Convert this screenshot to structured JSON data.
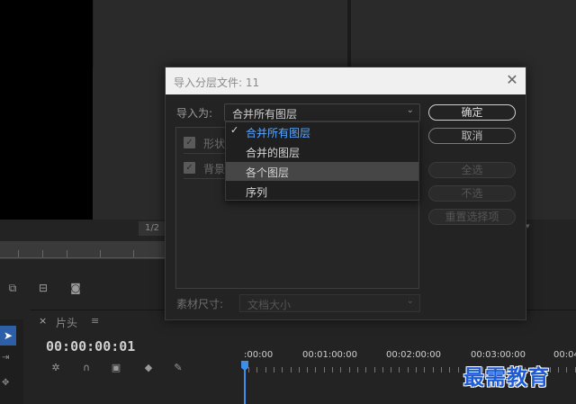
{
  "background": {
    "page_indicator": "1/2",
    "timeline": {
      "close": "×",
      "name": "片头",
      "menu_icon": "≡",
      "timecode": "00:00:00:01",
      "ruler_labels": [
        ":00:00",
        "00:01:00:00",
        "00:02:00:00",
        "00:03:00:00",
        "00:04"
      ]
    },
    "watermark": "最需教育"
  },
  "dialog": {
    "title": "导入分层文件: 11",
    "close_icon": "close-icon",
    "import_as_label": "导入为:",
    "import_as_value": "合并所有图层",
    "layer_options": [
      {
        "label": "形状",
        "checked": true
      },
      {
        "label": "背景",
        "checked": true
      }
    ],
    "footage_size_label": "素材尺寸:",
    "footage_size_value": "文档大小",
    "buttons": {
      "ok": "确定",
      "cancel": "取消",
      "select_all": "全选",
      "select_none": "不选",
      "reset_selection": "重置选择项"
    }
  },
  "dropdown": {
    "items": [
      {
        "label": "合并所有图层",
        "selected": true
      },
      {
        "label": "合并的图层",
        "selected": false
      },
      {
        "label": "各个图层",
        "selected": false,
        "hovered": true
      },
      {
        "label": "序列",
        "selected": false
      }
    ],
    "check_mark": "✓"
  },
  "colors": {
    "accent_blue": "#5aa7ff",
    "playhead": "#3d8ee8",
    "watermark": "#1e5bd7"
  }
}
